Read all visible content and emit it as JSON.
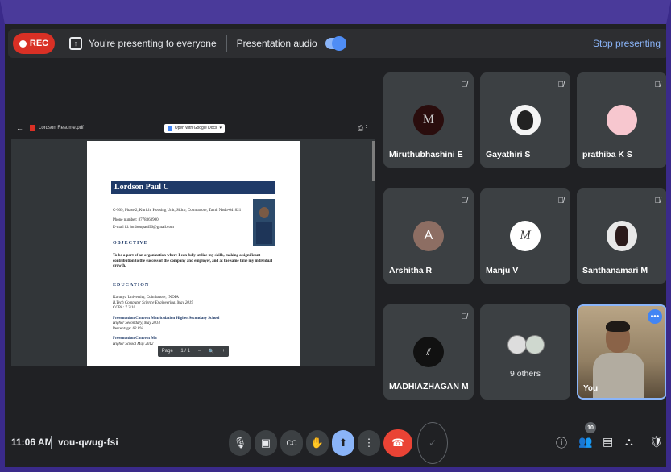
{
  "topbar": {
    "rec_label": "REC",
    "presenting_text": "You're presenting to everyone",
    "audio_label": "Presentation audio",
    "stop_label": "Stop presenting"
  },
  "pdf_viewer": {
    "file_name": "Lordson Resume.pdf",
    "open_with": "Open with Google Docs",
    "page_label": "Page"
  },
  "resume": {
    "name": "Lordson Paul C",
    "address": "C-509, Phase 2, Kurichi Housing Unit, Sidco, Coimbatore, Tamil Nadu-641021",
    "phone": "Phone number: 8778363900",
    "email": "E-mail id: lordsonpaul96@gmail.com",
    "objective_heading": "OBJECTIVE",
    "objective_text": "To be a part of an organization where I can fully utilize my skills, making a significant contribution to the success of the company and employer, and at the same time my individual growth.",
    "education_heading": "EDUCATION",
    "edu1_school": "Karunya University, Coimbatore, INDIA",
    "edu1_degree": "B.Tech Computer Science Engineering, May 2019",
    "edu1_grade": "CGPA: 7.2/10",
    "edu2_school": "Presentation Convent Matriculation Higher Secondary School",
    "edu2_degree": "Higher Secondary, May 2014",
    "edu2_grade": "Percentage: 62.8%",
    "edu3_school": "Presentation Convent Ma",
    "edu3_degree": "Higher School May 2012"
  },
  "participants": [
    {
      "name": "Miruthubhashini E",
      "initial": "M",
      "avatar_color": "#2a0d0d"
    },
    {
      "name": "Gayathiri S",
      "initial": "",
      "avatar_color": "#f4f4f4"
    },
    {
      "name": "prathiba K S",
      "initial": "",
      "avatar_color": "#f7c7cf"
    },
    {
      "name": "Arshitha R",
      "initial": "A",
      "avatar_color": "#8d6e63"
    },
    {
      "name": "Manju V",
      "initial": "M",
      "avatar_color": "#ffffff"
    },
    {
      "name": "Santhanamari M",
      "initial": "",
      "avatar_color": "#e8e8e8"
    },
    {
      "name": "MADHIAZHAGAN M",
      "initial": "",
      "avatar_color": "#111111"
    },
    {
      "name": "9 others",
      "initial": "",
      "avatar_color": "#dddddd"
    },
    {
      "name": "You",
      "initial": "",
      "avatar_color": ""
    }
  ],
  "bottom": {
    "time": "11:06 AM",
    "meeting_code": "vou-qwug-fsi",
    "people_count": "10"
  },
  "icons": [
    "mic-off-icon",
    "camera-icon",
    "captions-icon",
    "raise-hand-icon",
    "present-icon",
    "more-icon",
    "end-call-icon",
    "info-icon",
    "people-icon",
    "chat-icon",
    "activities-icon",
    "host-controls-icon"
  ]
}
